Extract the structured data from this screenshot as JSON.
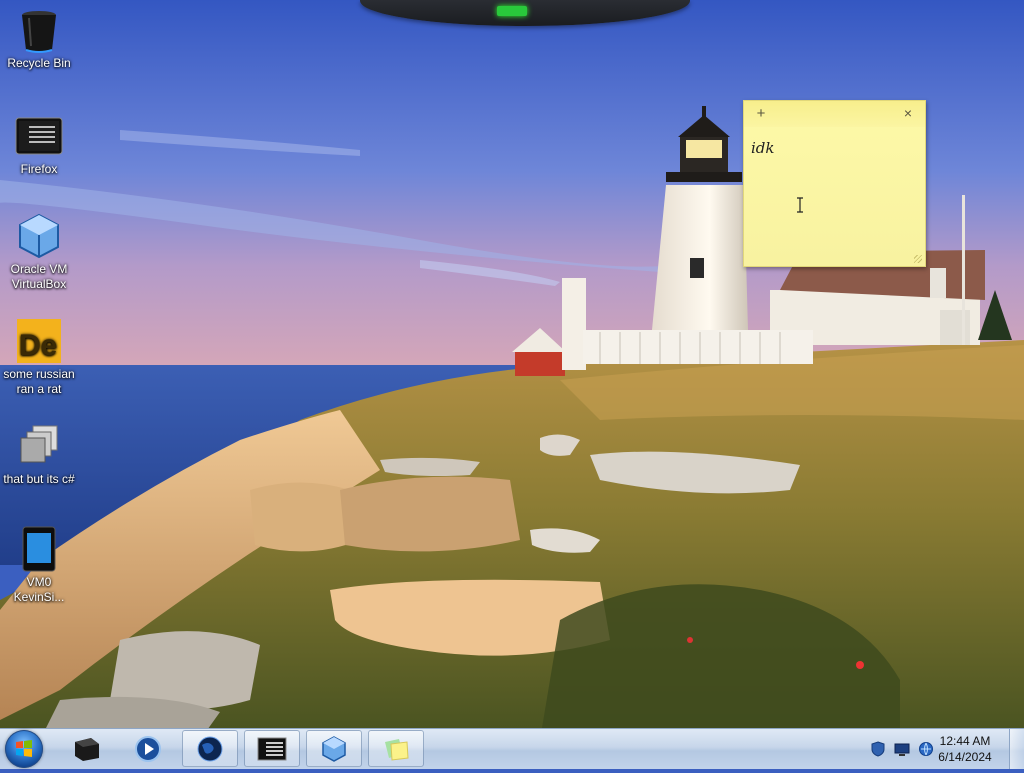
{
  "desktop": {
    "icons": [
      {
        "label": "Recycle Bin",
        "icon": "recycle-bin-icon"
      },
      {
        "label": "Firefox",
        "icon": "firefox-icon"
      },
      {
        "label": "Oracle VM VirtualBox",
        "icon": "virtualbox-icon"
      },
      {
        "label": "some russian ran a rat",
        "icon": "de-app-icon"
      },
      {
        "label": "that but its c#",
        "icon": "stacked-windows-icon"
      },
      {
        "label": "VM0 KevinSi...",
        "icon": "tablet-shortcut-icon"
      }
    ]
  },
  "sticky_note": {
    "add_label": "+",
    "close_label": "×",
    "text": "idk"
  },
  "taskbar": {
    "clock": {
      "time": "12:44 AM",
      "date": "6/14/2024"
    },
    "pinned": [
      "black-box-icon",
      "media-player-icon",
      "globe-icon",
      "terminal-icon",
      "virtualbox-icon",
      "sticky-notes-icon"
    ],
    "tray_icons": [
      "shield-icon",
      "monitor-icon",
      "network-icon"
    ]
  },
  "colors": {
    "sky_top": "#3f62c8",
    "sticky_bg": "#fdf9a8",
    "taskbar": "#c7d6ea"
  }
}
